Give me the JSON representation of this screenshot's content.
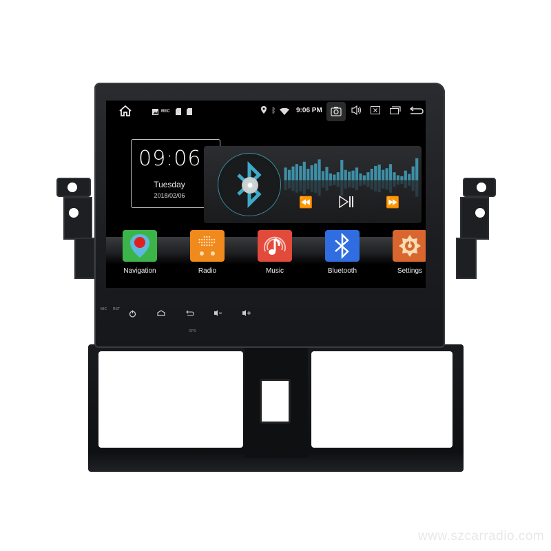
{
  "statusbar": {
    "home_icon": "home-icon",
    "notification_icons": [
      "image-icon",
      "rec-icon",
      "sd-card-icon",
      "sd-card-icon"
    ],
    "rec_label": "REC",
    "status_icons": [
      "location-icon",
      "bluetooth-icon",
      "wifi-icon"
    ],
    "time": "9:06 PM",
    "actions": [
      "camera-icon",
      "volume-icon",
      "close-app-icon",
      "recent-apps-icon",
      "back-icon"
    ]
  },
  "clock": {
    "time": "09:06",
    "day": "Tuesday",
    "date": "2018/02/06"
  },
  "player": {
    "source_icon": "bluetooth-icon",
    "controls": {
      "prev": "⏪",
      "play_pause": "⏯",
      "next": "⏩"
    },
    "equalizer_levels": [
      0.55,
      0.45,
      0.6,
      0.7,
      0.62,
      0.8,
      0.5,
      0.65,
      0.72,
      0.9,
      0.4,
      0.58,
      0.3,
      0.25,
      0.35,
      0.88,
      0.45,
      0.38,
      0.42,
      0.55,
      0.3,
      0.22,
      0.35,
      0.5,
      0.62,
      0.68,
      0.45,
      0.52,
      0.7,
      0.35,
      0.22,
      0.18,
      0.42,
      0.28,
      0.6,
      0.95
    ],
    "accent_color": "#3fa9c9"
  },
  "apps": [
    {
      "label": "Navigation",
      "color": "#3bb54a",
      "icon": "map-pin-icon"
    },
    {
      "label": "Radio",
      "color": "#f08a1c",
      "icon": "radio-icon"
    },
    {
      "label": "Music",
      "color": "#e24a3b",
      "icon": "music-note-icon"
    },
    {
      "label": "Bluetooth",
      "color": "#2f6de0",
      "icon": "bluetooth-icon"
    },
    {
      "label": "Settings",
      "color": "#d9662e",
      "icon": "gear-icon"
    }
  ],
  "hardware": {
    "mic_label": "MIC",
    "rst_label": "RST",
    "buttons": [
      "power-icon",
      "home-icon",
      "back-icon",
      "volume-down-icon",
      "volume-up-icon"
    ],
    "gps_label": "GPS"
  },
  "watermark": "www.szcarradio.com"
}
